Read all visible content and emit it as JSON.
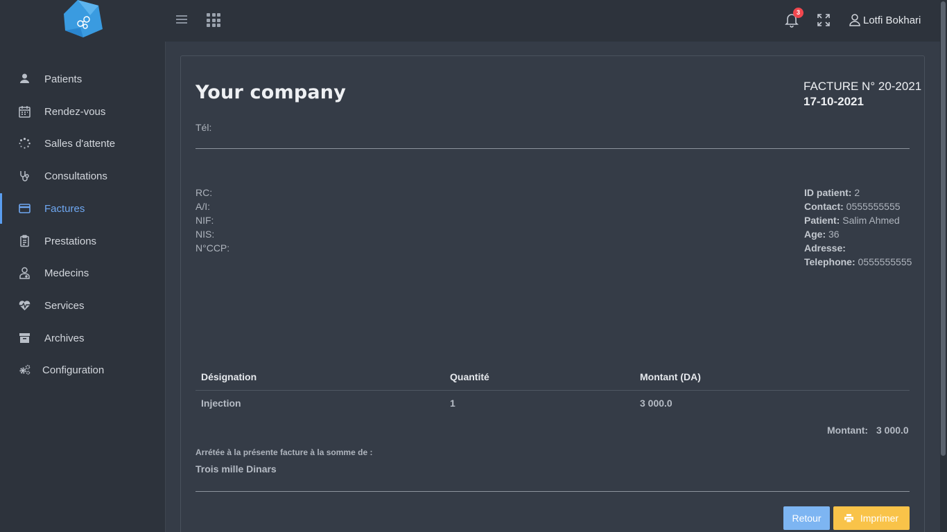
{
  "header": {
    "notification_count": "3",
    "user_name": "Lotfi Bokhari"
  },
  "sidebar": {
    "items": [
      {
        "label": "Patients",
        "icon": "user-icon"
      },
      {
        "label": "Rendez-vous",
        "icon": "calendar-icon"
      },
      {
        "label": "Salles d'attente",
        "icon": "spinner-icon"
      },
      {
        "label": "Consultations",
        "icon": "stethoscope-icon"
      },
      {
        "label": "Factures",
        "icon": "credit-card-icon",
        "active": true
      },
      {
        "label": "Prestations",
        "icon": "clipboard-icon"
      },
      {
        "label": "Medecins",
        "icon": "doctor-icon"
      },
      {
        "label": "Services",
        "icon": "heartbeat-icon"
      },
      {
        "label": "Archives",
        "icon": "archive-icon"
      },
      {
        "label": "Configuration",
        "icon": "gears-icon"
      }
    ]
  },
  "invoice": {
    "company": "Your company",
    "tel_label": "Tél:",
    "number": "FACTURE N° 20-2021",
    "date": "17-10-2021",
    "legal": [
      "RC:",
      "A/I:",
      "NIF:",
      "NIS:",
      "N°CCP:"
    ],
    "patient": {
      "id_label": "ID patient:",
      "id": "2",
      "contact_label": "Contact:",
      "contact": "0555555555",
      "patient_label": "Patient:",
      "name": "Salim Ahmed",
      "age_label": "Age:",
      "age": "36",
      "adresse_label": "Adresse:",
      "adresse": "",
      "telephone_label": "Telephone:",
      "telephone": "0555555555"
    },
    "table": {
      "headers": [
        "Désignation",
        "Quantité",
        "Montant (DA)"
      ],
      "rows": [
        [
          "Injection",
          "1",
          "3 000.0"
        ]
      ]
    },
    "total_label": "Montant:",
    "total": "3 000.0",
    "arrete": "Arrétée à la présente facture à la somme de :",
    "amount_words": "Trois mille Dinars",
    "btn_back": "Retour",
    "btn_print": "Imprimer"
  },
  "colors": {
    "background": "#353c47",
    "sidebar": "#2d333c",
    "accent": "#5a9ef0",
    "print_button": "#f9c349",
    "back_button": "#7db5f2",
    "badge": "#f1474e"
  }
}
